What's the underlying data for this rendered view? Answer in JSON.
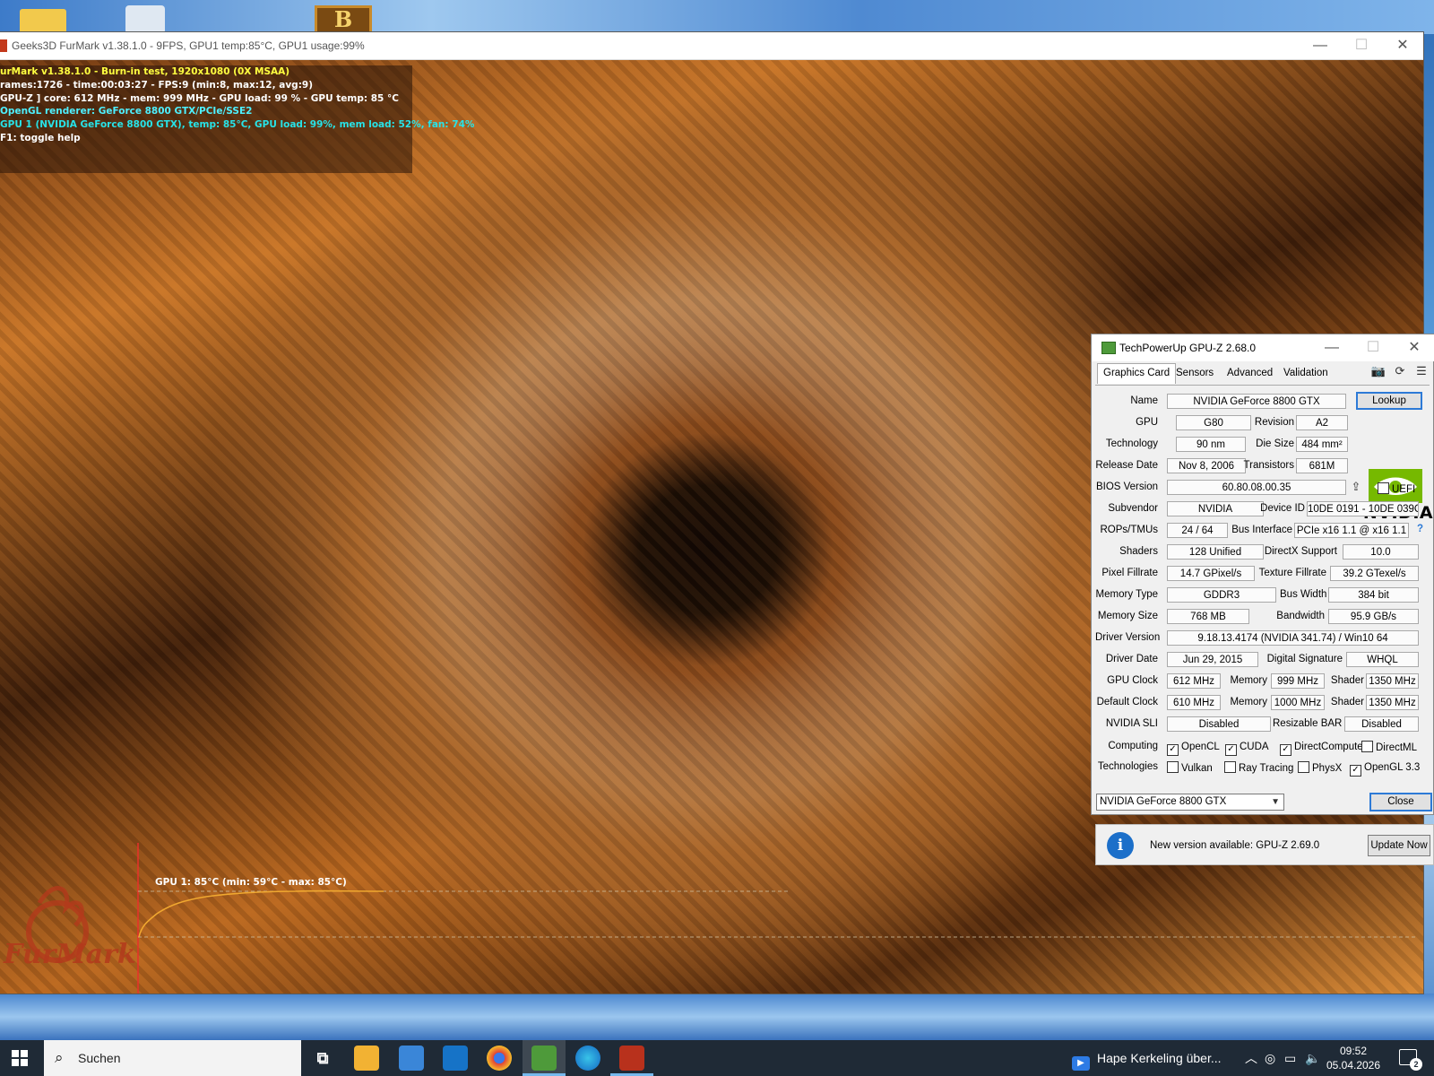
{
  "desktop": {
    "b_icon_letter": "B"
  },
  "furmark": {
    "title": "Geeks3D FurMark v1.38.1.0 - 9FPS, GPU1 temp:85°C, GPU1 usage:99%",
    "controls": {
      "minimize": "—",
      "maximize": "☐",
      "close": "✕"
    },
    "osd": {
      "line1": "urMark v1.38.1.0 - Burn-in test, 1920x1080 (0X MSAA)",
      "line2": "rames:1726 - time:00:03:27 - FPS:9 (min:8, max:12, avg:9)",
      "line3": "GPU-Z ] core: 612 MHz - mem: 999 MHz - GPU load: 99 % - GPU temp: 85 °C",
      "line4": "OpenGL renderer: GeForce 8800 GTX/PCIe/SSE2",
      "line5": "GPU 1 (NVIDIA GeForce 8800 GTX), temp: 85°C, GPU load: 99%, mem load: 52%, fan: 74%",
      "line6": "F1: toggle help"
    },
    "graph_label": "GPU 1: 85°C (min: 59°C - max: 85°C)",
    "logo_text": "FurMark",
    "colors": {
      "graph_line": "#f0a830",
      "graph_axis": "#3fb8d8",
      "graph_start": "#e8302a"
    }
  },
  "gpuz": {
    "title": "TechPowerUp GPU-Z 2.68.0",
    "controls": {
      "minimize": "—",
      "maximize": "☐",
      "close": "✕"
    },
    "tabs": [
      "Graphics Card",
      "Sensors",
      "Advanced",
      "Validation"
    ],
    "tools": {
      "camera": "📷",
      "refresh": "⟳",
      "menu": "☰"
    },
    "labels": {
      "name": "Name",
      "gpu": "GPU",
      "revision": "Revision",
      "technology": "Technology",
      "die_size": "Die Size",
      "release_date": "Release Date",
      "transistors": "Transistors",
      "bios_version": "BIOS Version",
      "uefi": "UEFI",
      "subvendor": "Subvendor",
      "device_id": "Device ID",
      "rops_tmus": "ROPs/TMUs",
      "bus_interface": "Bus Interface",
      "shaders": "Shaders",
      "directx_support": "DirectX Support",
      "pixel_fillrate": "Pixel Fillrate",
      "texture_fillrate": "Texture Fillrate",
      "memory_type": "Memory Type",
      "bus_width": "Bus Width",
      "memory_size": "Memory Size",
      "bandwidth": "Bandwidth",
      "driver_version": "Driver Version",
      "driver_date": "Driver Date",
      "digital_signature": "Digital Signature",
      "gpu_clock": "GPU Clock",
      "memory": "Memory",
      "shader": "Shader",
      "default_clock": "Default Clock",
      "nvidia_sli": "NVIDIA SLI",
      "resizable_bar": "Resizable BAR",
      "computing": "Computing",
      "technologies": "Technologies"
    },
    "values": {
      "name": "NVIDIA GeForce 8800 GTX",
      "gpu": "G80",
      "revision": "A2",
      "technology": "90 nm",
      "die_size": "484 mm²",
      "release_date": "Nov 8, 2006",
      "transistors": "681M",
      "bios_version": "60.80.08.00.35",
      "subvendor": "NVIDIA",
      "device_id": "10DE 0191 - 10DE 039C",
      "rops_tmus": "24 / 64",
      "bus_interface": "PCIe x16 1.1 @ x16 1.1",
      "shaders": "128 Unified",
      "directx_support": "10.0",
      "pixel_fillrate": "14.7 GPixel/s",
      "texture_fillrate": "39.2 GTexel/s",
      "memory_type": "GDDR3",
      "bus_width": "384 bit",
      "memory_size": "768 MB",
      "bandwidth": "95.9 GB/s",
      "driver_version": "9.18.13.4174 (NVIDIA 341.74) / Win10 64",
      "driver_date": "Jun 29, 2015",
      "digital_signature": "WHQL",
      "gpu_clock": "612 MHz",
      "gpu_memory": "999 MHz",
      "gpu_shader": "1350 MHz",
      "default_clock": "610 MHz",
      "default_memory": "1000 MHz",
      "default_shader": "1350 MHz",
      "nvidia_sli": "Disabled",
      "resizable_bar": "Disabled"
    },
    "lookup_label": "Lookup",
    "bus_help": "?",
    "computing": [
      {
        "label": "OpenCL",
        "checked": true
      },
      {
        "label": "CUDA",
        "checked": true
      },
      {
        "label": "DirectCompute",
        "checked": true
      },
      {
        "label": "DirectML",
        "checked": false
      }
    ],
    "technologies": [
      {
        "label": "Vulkan",
        "checked": false
      },
      {
        "label": "Ray Tracing",
        "checked": false
      },
      {
        "label": "PhysX",
        "checked": false
      },
      {
        "label": "OpenGL 3.3",
        "checked": true
      }
    ],
    "selected_card": "NVIDIA GeForce 8800 GTX",
    "close_label": "Close",
    "vendor_logo_text": "NVIDIA",
    "notify": {
      "icon": "i",
      "text": "New version available: GPU-Z 2.69.0",
      "button": "Update Now"
    }
  },
  "taskbar": {
    "search_placeholder": "Suchen",
    "media_text": "Hape Kerkeling über...",
    "time": "09:52",
    "date": "05.04.2026",
    "notification_count": "2",
    "icons": [
      "task-view-icon",
      "file-explorer-icon",
      "store-icon",
      "outlook-icon",
      "chrome-icon",
      "gpuz-taskbar-icon",
      "edge-icon",
      "furmark-taskbar-icon"
    ]
  }
}
